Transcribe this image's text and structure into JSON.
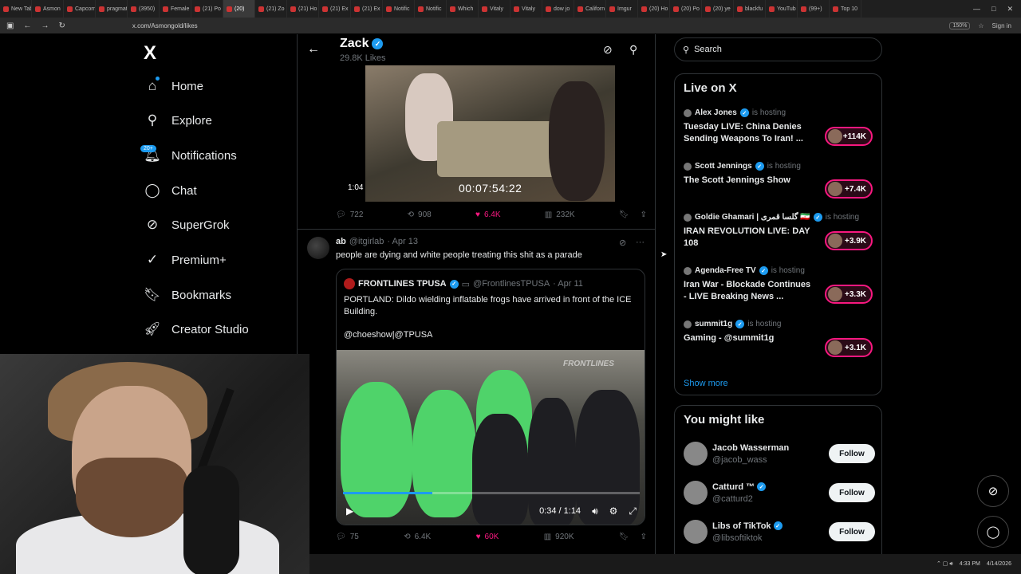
{
  "browser": {
    "tabs": [
      "New Tab",
      "Asmon",
      "Capcom",
      "pragmat",
      "(3950)",
      "Female",
      "(21) Po",
      "(20)",
      "(21) Zo",
      "(21) Ho",
      "(21) Ex",
      "(21) Ex",
      "Notific",
      "Notific",
      "Which",
      "Vitaly",
      "Vitaly",
      "dow jo",
      "Californ",
      "Imgur",
      "(20) Ho",
      "(20) Po",
      "(20) ye",
      "blackfu",
      "YouTub",
      "(99+)",
      "Top 10"
    ],
    "url": "x.com/Asmongold/likes",
    "zoom": "150%",
    "sign_in": "Sign in"
  },
  "sidebar": {
    "logo": "X",
    "notif_badge": "20+",
    "items": [
      {
        "label": "Home",
        "icon": "home-icon"
      },
      {
        "label": "Explore",
        "icon": "search-icon"
      },
      {
        "label": "Notifications",
        "icon": "bell-icon"
      },
      {
        "label": "Chat",
        "icon": "chat-icon"
      },
      {
        "label": "SuperGrok",
        "icon": "grok-icon"
      },
      {
        "label": "Premium+",
        "icon": "verified-icon"
      },
      {
        "label": "Bookmarks",
        "icon": "bookmark-icon"
      },
      {
        "label": "Creator Studio",
        "icon": "rocket-icon"
      }
    ]
  },
  "header": {
    "name": "Zack",
    "likes_count": "29.8K Likes"
  },
  "tweet1": {
    "duration": "1:04",
    "timestamp_overlay": "00:07:54:22",
    "replies": "722",
    "reposts": "908",
    "likes": "6.4K",
    "views": "232K"
  },
  "tweet2": {
    "name": "ab",
    "handle": "@itgirlab",
    "date": "· Apr 13",
    "text": "people are dying and white people treating this shit as a parade",
    "quote": {
      "name": "FRONTLINES TPUSA",
      "handle": "@FrontlinesTPUSA",
      "date": "· Apr 11",
      "text": "PORTLAND: Dildo wielding inflatable frogs have arrived in front of the ICE Building.",
      "tags": "@choeshow|@TPUSA",
      "watermark": "FRONTLINES",
      "video_time": "0:34 / 1:14",
      "progress": 0.3
    },
    "replies": "75",
    "reposts": "6.4K",
    "likes": "60K",
    "views": "920K"
  },
  "right": {
    "search_placeholder": "Search",
    "live_title": "Live on X",
    "hosting_text": "is hosting",
    "live": [
      {
        "host": "Alex Jones",
        "title": "Tuesday LIVE: China Denies Sending Weapons To Iran! ...",
        "count": "+114K"
      },
      {
        "host": "Scott Jennings",
        "title": "The Scott Jennings Show",
        "count": "+7.4K"
      },
      {
        "host": "Goldie Ghamari | گلسا قمری 🇮🇷",
        "title": "IRAN REVOLUTION LIVE: DAY 108",
        "count": "+3.9K"
      },
      {
        "host": "Agenda-Free TV",
        "title": "Iran War - Blockade Continues - LIVE Breaking News ...",
        "count": "+3.3K"
      },
      {
        "host": "summit1g",
        "title": "Gaming - @summit1g",
        "count": "+3.1K"
      }
    ],
    "show_more": "Show more",
    "suggest_title": "You might like",
    "suggestions": [
      {
        "name": "Jacob Wasserman",
        "handle": "@jacob_wass",
        "verified": false
      },
      {
        "name": "Catturd ™",
        "handle": "@catturd2",
        "verified": true
      },
      {
        "name": "Libs of TikTok",
        "handle": "@libsoftiktok",
        "verified": true
      }
    ],
    "follow_label": "Follow"
  },
  "taskbar": {
    "time": "4:33 PM",
    "date": "4/14/2026"
  }
}
